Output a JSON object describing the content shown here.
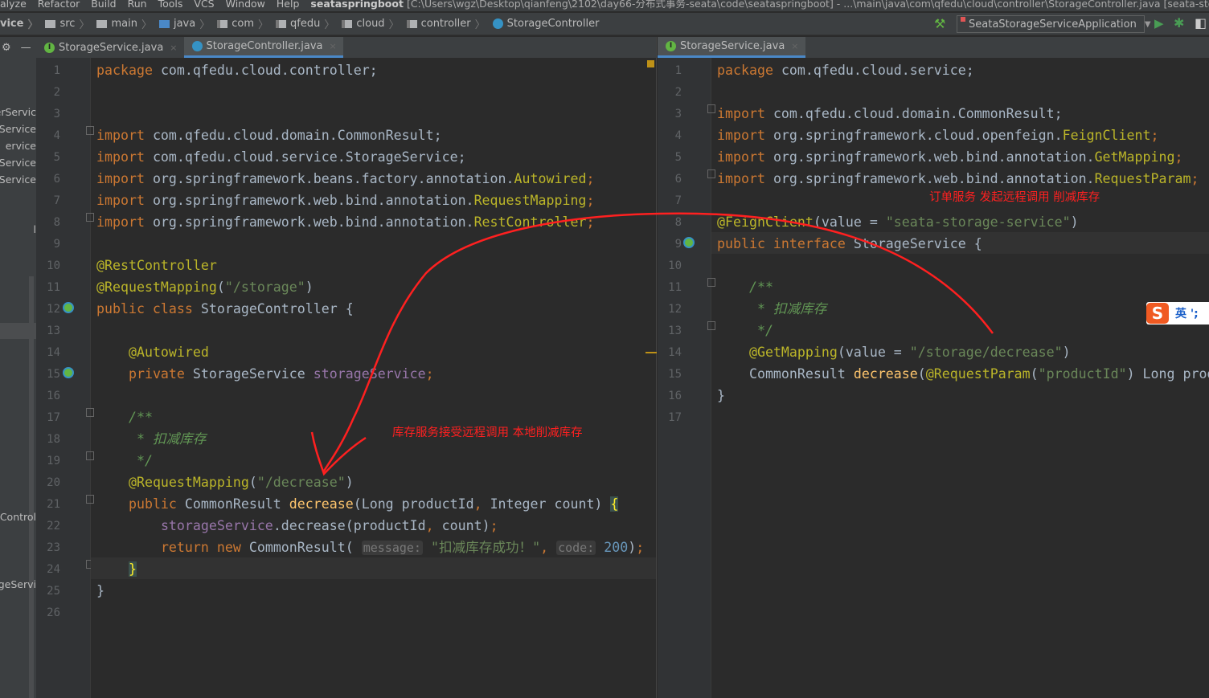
{
  "menubar": {
    "items": [
      "alyze",
      "Refactor",
      "Build",
      "Run",
      "Tools",
      "VCS",
      "Window",
      "Help"
    ],
    "project": "seataspringboot",
    "path": "[C:\\Users\\wgz\\Desktop\\qianfeng\\2102\\day66-分布式事务-seata\\code\\seataspringboot] - ...\\main\\java\\com\\qfedu\\cloud\\controller\\StorageController.java [seata-storage-service]"
  },
  "breadcrumb": {
    "module": "vice",
    "items": [
      "src",
      "main",
      "java",
      "com",
      "qfedu",
      "cloud",
      "controller"
    ],
    "current": "StorageController"
  },
  "run_config": {
    "label": "SeataStorageServiceApplication",
    "icons": [
      "hammer-icon",
      "run-icon",
      "debug-icon",
      "coverage-icon"
    ]
  },
  "left_tabs": [
    {
      "label": "StorageService.java",
      "icon": "interface-icon",
      "active": false
    },
    {
      "label": "StorageController.java",
      "icon": "class-icon",
      "active": true
    }
  ],
  "right_tabs": [
    {
      "label": "StorageService.java",
      "icon": "interface-icon",
      "active": true
    }
  ],
  "project_tree": [
    "erServic",
    "Service",
    "ervice",
    "Service",
    "rService",
    "l",
    "Control",
    "geServi"
  ],
  "left_code": [
    [
      [
        "k",
        "package "
      ],
      [
        "t",
        "com.qfedu.cloud.controller;"
      ]
    ],
    [],
    [],
    [
      [
        "k",
        "import "
      ],
      [
        "t",
        "com.qfedu.cloud.domain.CommonResult;"
      ]
    ],
    [
      [
        "k",
        "import "
      ],
      [
        "t",
        "com.qfedu.cloud.service.StorageService;"
      ]
    ],
    [
      [
        "k",
        "import "
      ],
      [
        "t",
        "org.springframework.beans.factory.annotation."
      ],
      [
        "a",
        "Autowired"
      ],
      [
        "k",
        ";"
      ]
    ],
    [
      [
        "k",
        "import "
      ],
      [
        "t",
        "org.springframework.web.bind.annotation."
      ],
      [
        "a",
        "RequestMapping"
      ],
      [
        "k",
        ";"
      ]
    ],
    [
      [
        "k",
        "import "
      ],
      [
        "t",
        "org.springframework.web.bind.annotation."
      ],
      [
        "a",
        "RestController"
      ],
      [
        "k",
        ";"
      ]
    ],
    [],
    [
      [
        "a",
        "@RestController"
      ]
    ],
    [
      [
        "a",
        "@RequestMapping"
      ],
      [
        "t",
        "("
      ],
      [
        "s",
        "\"/storage\""
      ],
      [
        "t",
        ")"
      ]
    ],
    [
      [
        "k",
        "public class "
      ],
      [
        "t",
        "StorageController {"
      ]
    ],
    [],
    [
      [
        "t",
        "    "
      ],
      [
        "a",
        "@Autowired"
      ]
    ],
    [
      [
        "t",
        "    "
      ],
      [
        "k",
        "private "
      ],
      [
        "t",
        "StorageService "
      ],
      [
        "f",
        "storageService"
      ],
      [
        "k",
        ";"
      ]
    ],
    [],
    [
      [
        "t",
        "    "
      ],
      [
        "c",
        "/**"
      ]
    ],
    [
      [
        "t",
        "     "
      ],
      [
        "c",
        "* 扣减库存"
      ]
    ],
    [
      [
        "t",
        "     "
      ],
      [
        "c",
        "*/"
      ]
    ],
    [
      [
        "t",
        "    "
      ],
      [
        "a",
        "@RequestMapping"
      ],
      [
        "t",
        "("
      ],
      [
        "s",
        "\"/decrease\""
      ],
      [
        "t",
        ")"
      ]
    ],
    [
      [
        "t",
        "    "
      ],
      [
        "k",
        "public "
      ],
      [
        "t",
        "CommonResult "
      ],
      [
        "m",
        "decrease"
      ],
      [
        "t",
        "(Long productId"
      ],
      [
        "k",
        ", "
      ],
      [
        "t",
        "Integer count) "
      ],
      [
        "br",
        "{"
      ]
    ],
    [
      [
        "t",
        "        "
      ],
      [
        "f",
        "storageService"
      ],
      [
        "t",
        ".decrease(productId"
      ],
      [
        "k",
        ", "
      ],
      [
        "t",
        "count)"
      ],
      [
        "k",
        ";"
      ]
    ],
    [
      [
        "t",
        "        "
      ],
      [
        "k",
        "return new "
      ],
      [
        "t",
        "CommonResult( "
      ],
      [
        "h",
        "message:"
      ],
      [
        "s",
        " \"扣减库存成功！\""
      ],
      [
        "k",
        ", "
      ],
      [
        "h",
        "code:"
      ],
      [
        "n",
        " 200"
      ],
      [
        "t",
        ")"
      ],
      [
        "k",
        ";"
      ]
    ],
    [
      [
        "t",
        "    "
      ],
      [
        "br",
        "}"
      ]
    ],
    [
      [
        "t",
        "}"
      ]
    ],
    []
  ],
  "right_code": [
    [
      [
        "k",
        "package "
      ],
      [
        "t",
        "com.qfedu.cloud.service;"
      ]
    ],
    [],
    [
      [
        "k",
        "import "
      ],
      [
        "t",
        "com.qfedu.cloud.domain.CommonResult;"
      ]
    ],
    [
      [
        "k",
        "import "
      ],
      [
        "t",
        "org.springframework.cloud.openfeign."
      ],
      [
        "a",
        "FeignClient"
      ],
      [
        "k",
        ";"
      ]
    ],
    [
      [
        "k",
        "import "
      ],
      [
        "t",
        "org.springframework.web.bind.annotation."
      ],
      [
        "a",
        "GetMapping"
      ],
      [
        "k",
        ";"
      ]
    ],
    [
      [
        "k",
        "import "
      ],
      [
        "t",
        "org.springframework.web.bind.annotation."
      ],
      [
        "a",
        "RequestParam"
      ],
      [
        "k",
        ";"
      ]
    ],
    [],
    [
      [
        "a",
        "@FeignClient"
      ],
      [
        "t",
        "(value = "
      ],
      [
        "s",
        "\"seata-storage-service\""
      ],
      [
        "t",
        ")"
      ]
    ],
    [
      [
        "k",
        "public interface "
      ],
      [
        "t",
        "StorageService {"
      ]
    ],
    [],
    [
      [
        "t",
        "    "
      ],
      [
        "c",
        "/**"
      ]
    ],
    [
      [
        "t",
        "     "
      ],
      [
        "c",
        "* 扣减库存"
      ]
    ],
    [
      [
        "t",
        "     "
      ],
      [
        "c",
        "*/"
      ]
    ],
    [
      [
        "t",
        "    "
      ],
      [
        "a",
        "@GetMapping"
      ],
      [
        "t",
        "(value = "
      ],
      [
        "s",
        "\"/storage/decrease\""
      ],
      [
        "t",
        ")"
      ]
    ],
    [
      [
        "t",
        "    CommonResult "
      ],
      [
        "m",
        "decrease"
      ],
      [
        "t",
        "("
      ],
      [
        "a",
        "@RequestParam"
      ],
      [
        "t",
        "("
      ],
      [
        "s",
        "\"productId\""
      ],
      [
        "t",
        ") Long productId"
      ]
    ],
    [
      [
        "t",
        "}"
      ]
    ],
    []
  ],
  "annotations": {
    "right_note": "订单服务  发起远程调用  削减库存",
    "left_note": "库存服务接受远程调用 本地削减库存",
    "color": "#FF2020"
  },
  "ime": {
    "logo": "S",
    "lang": "英 ';"
  },
  "colors": {
    "background": "#2B2B2B",
    "keyword": "#CC7832",
    "string": "#6A8759",
    "annotation": "#BBB529",
    "comment": "#629755",
    "accent": "#4A88C7"
  }
}
